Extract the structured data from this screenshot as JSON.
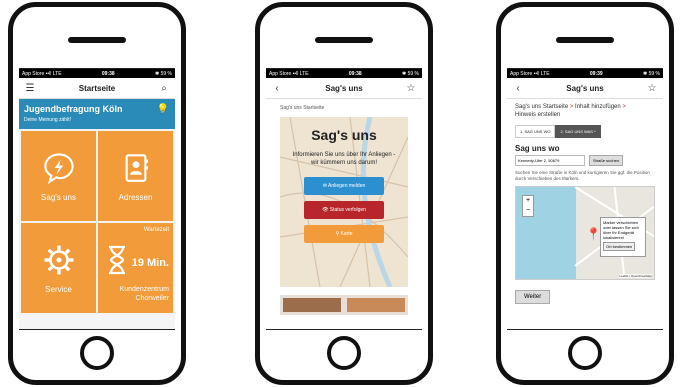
{
  "phone1": {
    "status": {
      "left": "App Store ••ll LTE",
      "time": "09:38",
      "right": "✱ 59 %"
    },
    "nav_title": "Startseite",
    "hero_title": "Jugendbefragung Köln",
    "hero_sub": "Deine Meinung zählt!",
    "tiles": {
      "sags": "Sag's uns",
      "adressen": "Adressen",
      "service": "Service",
      "wartezeit_label": "Wartezeit",
      "wartezeit_value": "19 Min.",
      "kundenzentrum": "Kundenzentrum",
      "chorweiler": "Chorweiler"
    }
  },
  "phone2": {
    "status": {
      "left": "App Store ••ll LTE",
      "time": "09:38",
      "right": "✱ 59 %"
    },
    "nav_title": "Sag's uns",
    "breadcrumb": "Sag's uns Startseite",
    "card_title": "Sag's uns",
    "card_desc": "Informieren Sie uns über Ihr Anliegen - wir kümmern uns darum!",
    "btn_melden": "✉ Anliegen melden",
    "btn_status": "👁 Status verfolgen",
    "btn_karte": "⚲ Karte"
  },
  "phone3": {
    "status": {
      "left": "App Store ••ll LTE",
      "time": "09:39",
      "right": "✱ 59 %"
    },
    "nav_title": "Sag's uns",
    "crumb_a": "Sag's uns Startseite",
    "crumb_b": "Inhalt hinzufügen",
    "crumb_c": "Hinweis erstellen",
    "tab1": "1. SAG UNS WO",
    "tab2": "2. SAG UNS WAS *",
    "heading": "Sag uns wo",
    "address": "Kennedy-Ufer 2, 50679",
    "btn_search": "Straße suchen",
    "hint": "Suchen Sie eine Straße in Köln und korrigieren Sie ggf. die Position durch Verschieben des Markers.",
    "popup_text": "Marker verschieben oder lassen Sie sich über Ihr Endgerät lokalisieren!",
    "popup_btn": "Ort bestimmen",
    "attribution": "Leaflet | OpenStreetMap",
    "weiter": "Weiter"
  }
}
